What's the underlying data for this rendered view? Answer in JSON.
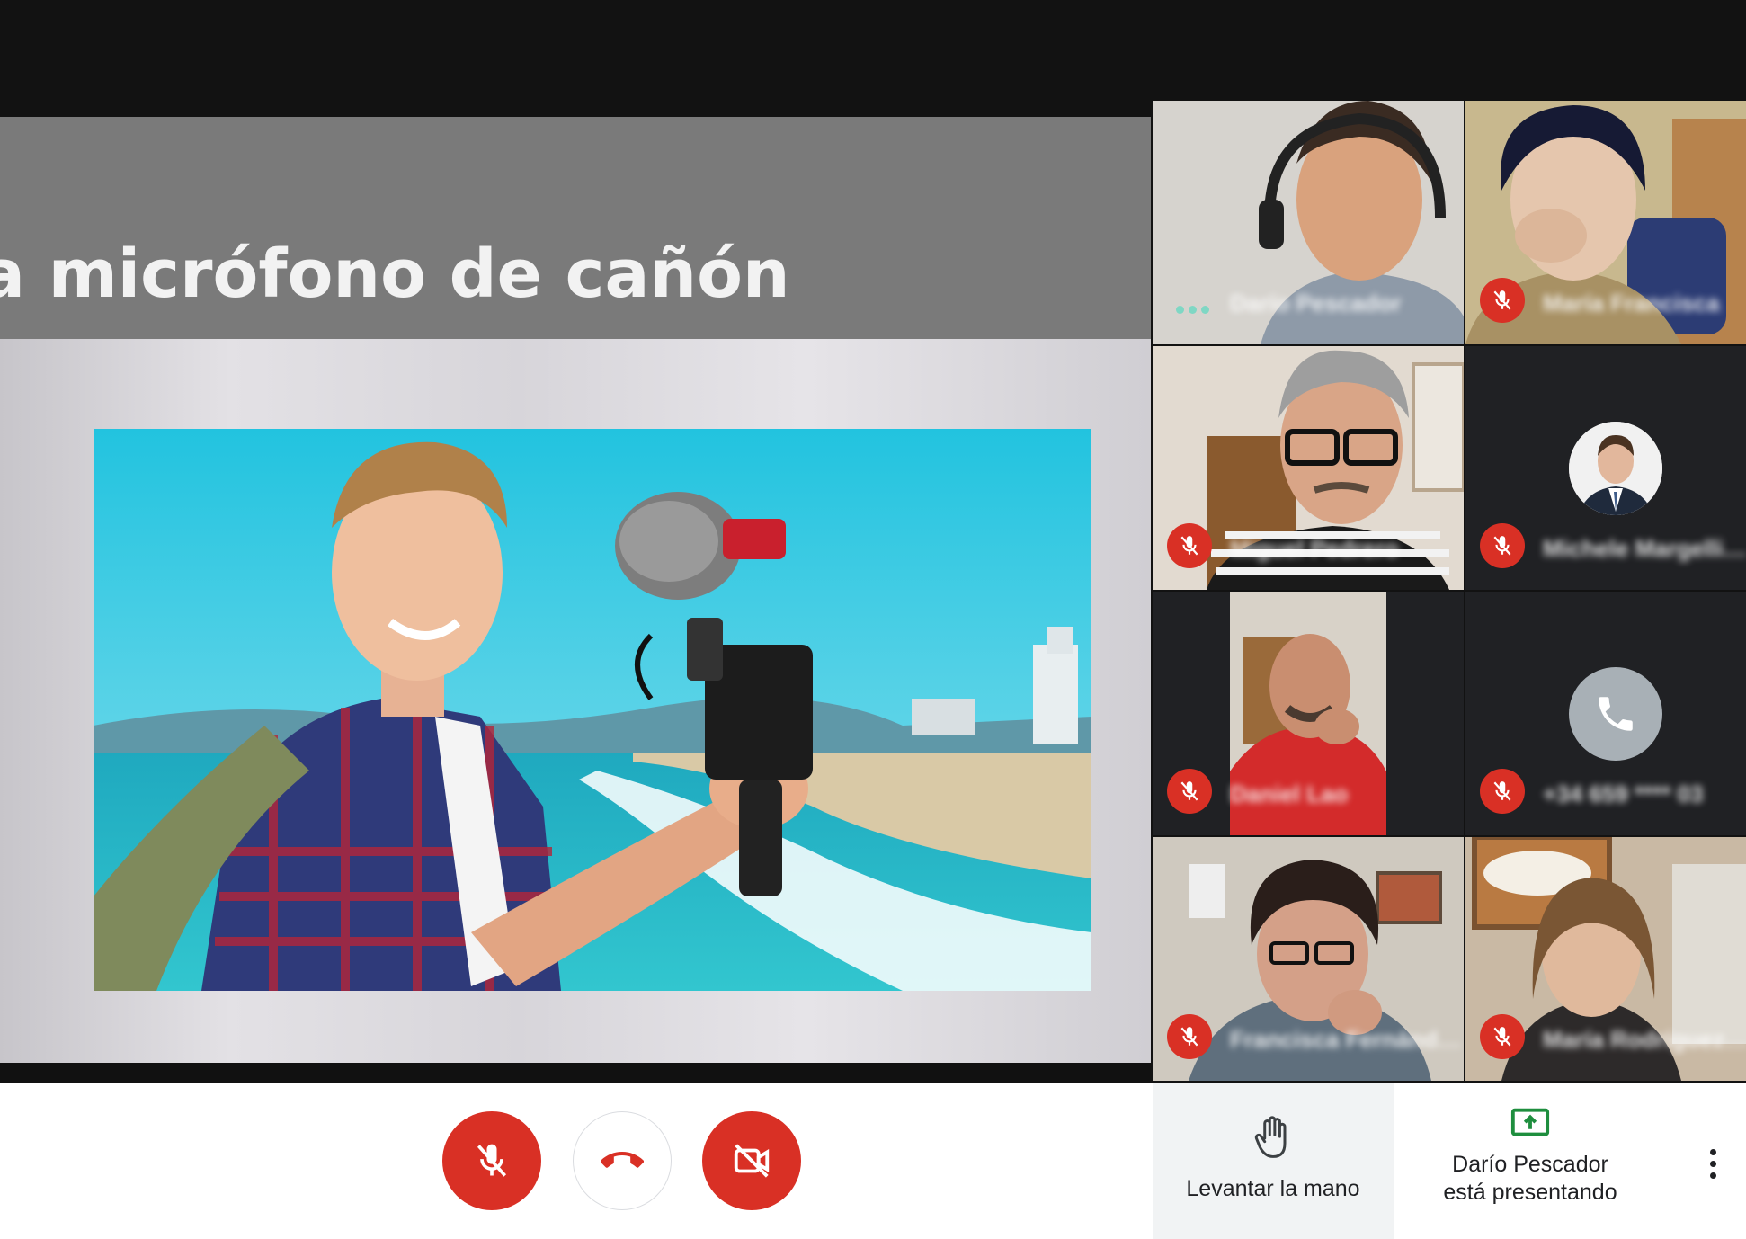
{
  "presentation": {
    "slide_title": "a micrófono de cañón"
  },
  "participants": [
    {
      "name": "Darío Pescador",
      "muted": false,
      "speaking": true
    },
    {
      "name": "María Francisca",
      "muted": true
    },
    {
      "name": "Miguel Pedrero",
      "muted": true
    },
    {
      "name": "Michele Margelli…",
      "muted": true,
      "avatar": true
    },
    {
      "name": "Daniel Lao",
      "muted": true
    },
    {
      "name": "+34 659 **** 03",
      "muted": true,
      "phone": true
    },
    {
      "name": "Francisca Fernánd…",
      "muted": true
    },
    {
      "name": "María Rodríguez…",
      "muted": true
    }
  ],
  "controls": {
    "mic_icon": "mic-off-icon",
    "hangup_icon": "phone-hangup-icon",
    "camera_icon": "videocam-off-icon",
    "raise_hand_label": "Levantar la mano",
    "presenting_line1": "Darío Pescador",
    "presenting_line2": "está presentando"
  },
  "colors": {
    "accent_red": "#d93025",
    "presenting_green": "#1e8e3e",
    "speaking_teal": "#7fd7c4"
  }
}
